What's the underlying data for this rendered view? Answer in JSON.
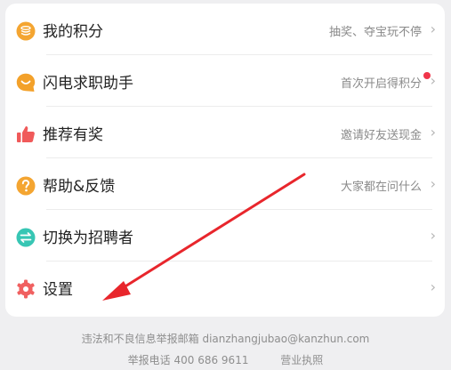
{
  "menu": {
    "items": [
      {
        "label": "我的积分",
        "hint": "抽奖、夺宝玩不停",
        "icon": "coin-stack-icon",
        "icon_color": "#f4a531"
      },
      {
        "label": "闪电求职助手",
        "hint": "首次开启得积分",
        "icon": "smile-chat-icon",
        "icon_color": "#f3a12a",
        "badge": true
      },
      {
        "label": "推荐有奖",
        "hint": "邀请好友送现金",
        "icon": "thumbs-up-icon",
        "icon_color": "#f05a5a"
      },
      {
        "label": "帮助&反馈",
        "hint": "大家都在问什么",
        "icon": "question-icon",
        "icon_color": "#f4a531"
      },
      {
        "label": "切换为招聘者",
        "hint": "",
        "icon": "switch-arrows-icon",
        "icon_color": "#37c6b4"
      },
      {
        "label": "设置",
        "hint": "",
        "icon": "gear-icon",
        "icon_color": "#f06060"
      }
    ],
    "chevron": "›"
  },
  "annotation": {
    "arrow_color": "#e8262c"
  },
  "footer": {
    "report_text": "违法和不良信息举报邮箱",
    "report_email": "dianzhangjubao@kanzhun.com",
    "phone_text": "举报电话 400 686 9611",
    "license_text": "营业执照"
  }
}
